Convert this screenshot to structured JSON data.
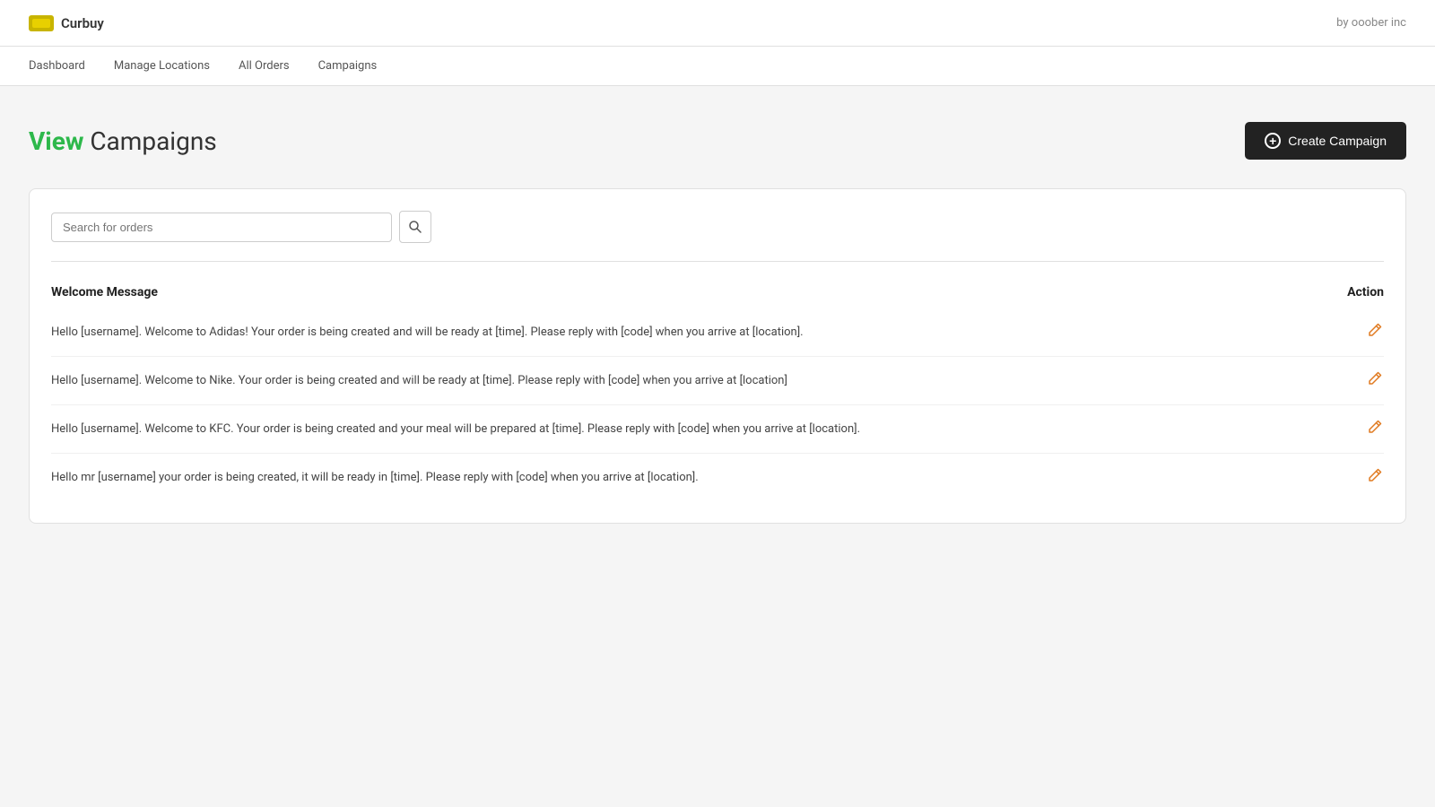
{
  "app": {
    "name": "Curbuy",
    "byline": "by ooober inc"
  },
  "nav": {
    "items": [
      {
        "label": "Dashboard",
        "id": "dashboard"
      },
      {
        "label": "Manage Locations",
        "id": "manage-locations"
      },
      {
        "label": "All Orders",
        "id": "all-orders"
      },
      {
        "label": "Campaigns",
        "id": "campaigns"
      }
    ]
  },
  "page": {
    "title_highlight": "View",
    "title_rest": " Campaigns",
    "create_button_label": "Create Campaign"
  },
  "search": {
    "placeholder": "Search for orders"
  },
  "table": {
    "columns": {
      "message": "Welcome Message",
      "action": "Action"
    },
    "rows": [
      {
        "id": 1,
        "message": "Hello [username]. Welcome to Adidas! Your order is being created and will be ready at [time]. Please reply with [code] when you arrive at [location]."
      },
      {
        "id": 2,
        "message": "Hello [username]. Welcome to Nike. Your order is being created and will be ready at [time]. Please reply with [code] when you arrive at [location]"
      },
      {
        "id": 3,
        "message": "Hello [username]. Welcome to KFC. Your order is being created and your meal will be prepared at [time]. Please reply with [code] when you arrive at [location]."
      },
      {
        "id": 4,
        "message": "Hello mr [username] your order is being created, it will be ready in [time]. Please reply with [code] when you arrive at [location]."
      }
    ]
  },
  "colors": {
    "green_accent": "#2db84b",
    "orange_icon": "#e07a20",
    "dark_button": "#222222"
  }
}
